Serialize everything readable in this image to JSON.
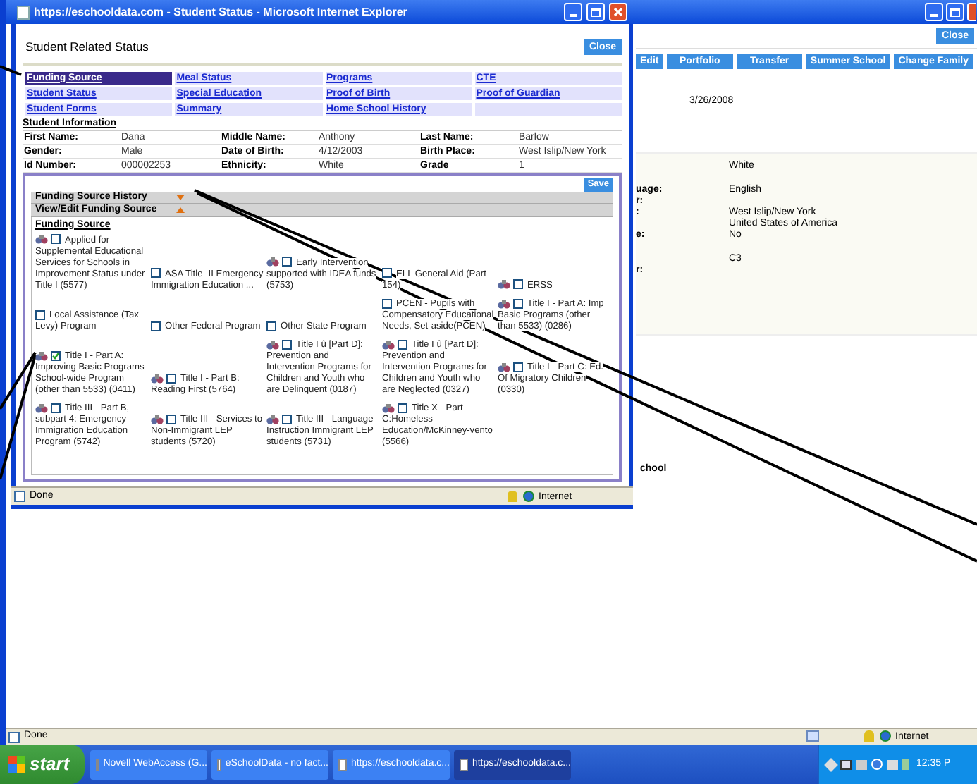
{
  "background_window": {
    "close_button": "Close",
    "toolbar_buttons": [
      "Edit",
      "Portfolio",
      "Transfer",
      "Summer School",
      "Change Family"
    ],
    "date": "3/26/2008",
    "detail_groups": [
      [
        {
          "value": "White"
        }
      ],
      [
        {
          "label": "uage:",
          "value": "English"
        },
        {
          "label": "r:"
        },
        {
          "label": ":",
          "value": "West Islip/New York"
        },
        {
          "value": "United States of America"
        },
        {
          "label": "e:",
          "value": "No"
        }
      ],
      [
        {
          "value": "C3"
        },
        {
          "label": "r:"
        }
      ]
    ],
    "section_label": "chool",
    "status": {
      "text": "Done",
      "zone": "Internet"
    }
  },
  "popup": {
    "title": "https://eschooldata.com - Student Status - Microsoft Internet Explorer",
    "heading": "Student Related Status",
    "close_button": "Close",
    "tabs": [
      {
        "label": "Funding Source",
        "selected": true
      },
      {
        "label": "Meal Status",
        "selected": false
      },
      {
        "label": "Programs",
        "selected": false
      },
      {
        "label": "CTE",
        "selected": false
      },
      {
        "label": "Student Status",
        "selected": false
      },
      {
        "label": "Special Education",
        "selected": false
      },
      {
        "label": "Proof of Birth",
        "selected": false
      },
      {
        "label": "Proof of Guardian",
        "selected": false
      },
      {
        "label": "Student Forms",
        "selected": false
      },
      {
        "label": "Summary",
        "selected": false
      },
      {
        "label": "Home School History",
        "selected": false
      }
    ],
    "student_information": {
      "title": "Student Information",
      "fields": [
        {
          "label": "First Name:",
          "value": "Dana"
        },
        {
          "label": "Middle Name:",
          "value": "Anthony"
        },
        {
          "label": "Last Name:",
          "value": "Barlow"
        },
        {
          "label": "Gender:",
          "value": "Male"
        },
        {
          "label": "Date of Birth:",
          "value": "4/12/2003"
        },
        {
          "label": "Birth Place:",
          "value": "West Islip/New York"
        },
        {
          "label": "Id Number:",
          "value": "000002253"
        },
        {
          "label": "Ethnicity:",
          "value": "White"
        },
        {
          "label": "Grade",
          "value": "1"
        }
      ]
    },
    "save_button": "Save",
    "sections": [
      {
        "label": "Funding Source History",
        "expanded": false
      },
      {
        "label": "View/Edit Funding Source",
        "expanded": true
      }
    ],
    "funding_source": {
      "title": "Funding Source",
      "items": [
        {
          "label": "Applied for Supplemental Educational Services for Schools in Improvement Status under Title I (5577)",
          "has_icon": true,
          "checked": false
        },
        {
          "label": "ASA Title -II Emergency Immigration Education ...",
          "has_icon": false,
          "checked": false
        },
        {
          "label": "Early Intervention supported with IDEA funds (5753)",
          "has_icon": true,
          "checked": false
        },
        {
          "label": "ELL General Aid (Part 154)",
          "has_icon": false,
          "checked": false
        },
        {
          "label": "ERSS",
          "has_icon": true,
          "checked": false
        },
        {
          "label": "Local Assistance (Tax Levy) Program",
          "has_icon": false,
          "checked": false
        },
        {
          "label": "Other Federal Program",
          "has_icon": false,
          "checked": false
        },
        {
          "label": "Other State Program",
          "has_icon": false,
          "checked": false
        },
        {
          "label": "PCEN - Pupils with Compensatory Educational Needs, Set-aside(PCEN)",
          "has_icon": false,
          "checked": false
        },
        {
          "label": "Title I - Part A: Imp Basic Programs (other than 5533) (0286)",
          "has_icon": true,
          "checked": false
        },
        {
          "label": "Title I - Part A: Improving Basic Programs School-wide Program (other than 5533) (0411)",
          "has_icon": true,
          "checked": true
        },
        {
          "label": "Title I - Part B: Reading First (5764)",
          "has_icon": true,
          "checked": false
        },
        {
          "label": "Title I û [Part D]: Prevention and Intervention Programs for Children and Youth who are Delinquent (0187)",
          "has_icon": true,
          "checked": false
        },
        {
          "label": "Title I û [Part D]: Prevention and Intervention Programs for Children and Youth who are Neglected (0327)",
          "has_icon": true,
          "checked": false
        },
        {
          "label": "Title I - Part C: Ed. Of Migratory Children (0330)",
          "has_icon": true,
          "checked": false
        },
        {
          "label": "Title III - Part B, subpart 4: Emergency Immigration Education Program (5742)",
          "has_icon": true,
          "checked": false
        },
        {
          "label": "Title III - Services to Non-Immigrant LEP students (5720)",
          "has_icon": true,
          "checked": false
        },
        {
          "label": "Title III - Language Instruction Immigrant LEP students (5731)",
          "has_icon": true,
          "checked": false
        },
        {
          "label": "Title X - Part C:Homeless Education/McKinney-vento (5566)",
          "has_icon": true,
          "checked": false
        }
      ]
    },
    "status": {
      "text": "Done",
      "zone": "Internet"
    }
  },
  "taskbar": {
    "start": "start",
    "tasks": [
      {
        "label": "Novell WebAccess (G...",
        "selected": false
      },
      {
        "label": "eSchoolData - no fact...",
        "selected": false
      },
      {
        "label": "https://eschooldata.c...",
        "selected": false
      },
      {
        "label": "https://eschooldata.c...",
        "selected": true
      }
    ],
    "clock": "12:35 P"
  }
}
